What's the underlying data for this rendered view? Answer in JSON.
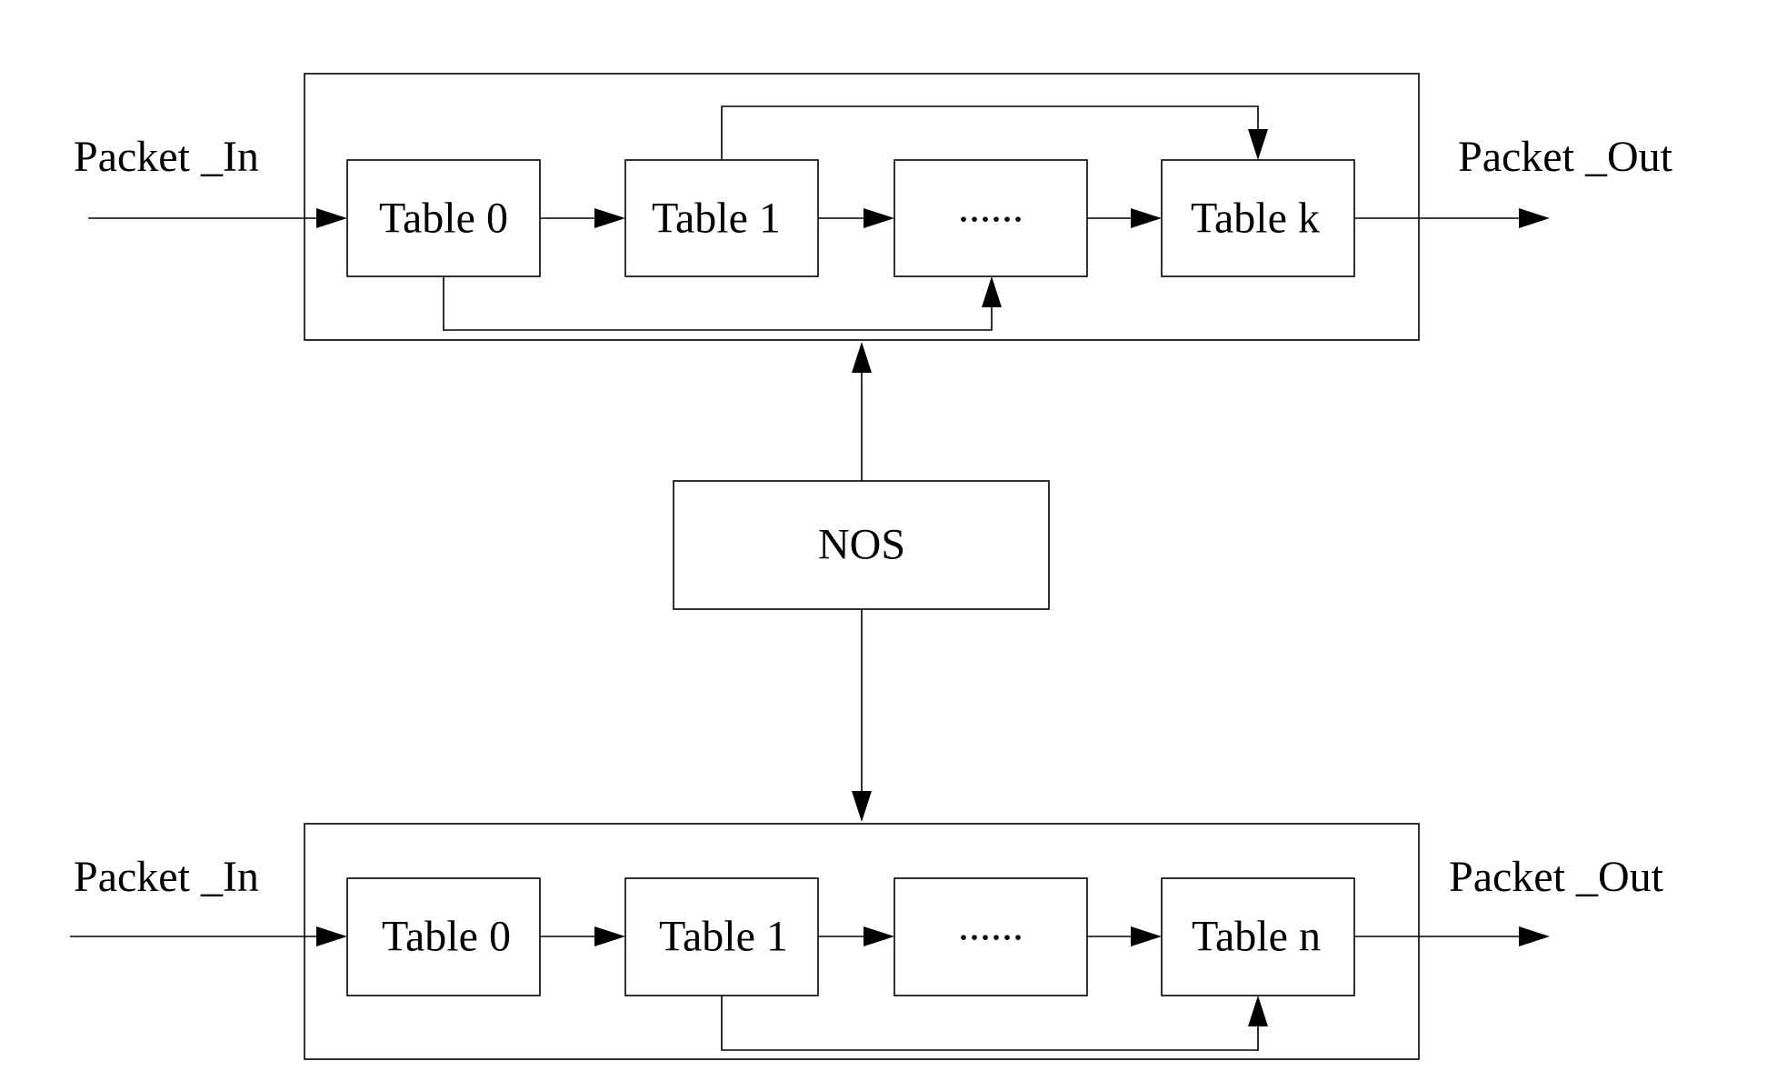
{
  "diagram": {
    "top_pipeline": {
      "input_label": "Packet _In",
      "output_label": "Packet _Out",
      "tables": [
        "Table 0",
        "Table 1",
        "......",
        "Table k"
      ],
      "skip_links": [
        {
          "from": "Table 1",
          "to": "Table k"
        },
        {
          "from": "Table 0",
          "to": "......"
        }
      ]
    },
    "controller": {
      "label": "NOS",
      "links": [
        "to top_pipeline",
        "to bottom_pipeline"
      ]
    },
    "bottom_pipeline": {
      "input_label": "Packet _In",
      "output_label": "Packet _Out",
      "tables": [
        "Table 0",
        "Table 1",
        "......",
        "Table n"
      ],
      "skip_links": [
        {
          "from": "Table 1",
          "to": "Table n"
        }
      ]
    },
    "colors": {
      "stroke": "#000000",
      "background": "#ffffff"
    }
  }
}
